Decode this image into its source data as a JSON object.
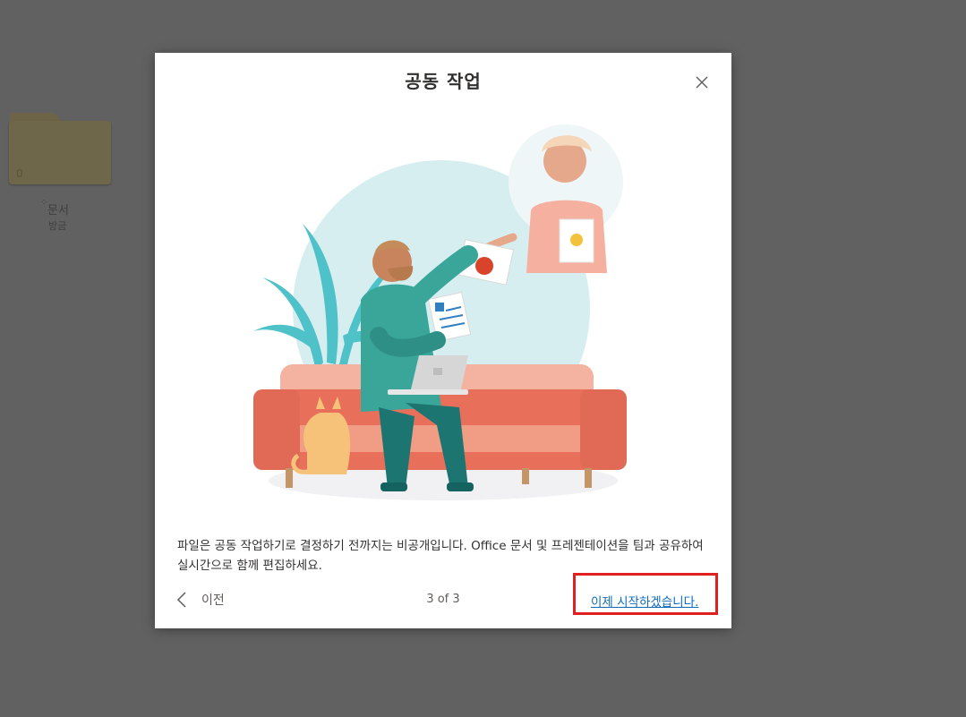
{
  "background": {
    "folder": {
      "count": "0",
      "name": "문서",
      "time": "방금"
    }
  },
  "dialog": {
    "title": "공동 작업",
    "description": "파일은 공동 작업하기로 결정하기 전까지는 비공개입니다. Office 문서 및 프레젠테이션을 팀과 공유하여 실시간으로 함께 편집하세요.",
    "prev_label": "이전",
    "page_indicator": "3 of 3",
    "start_label": "이제 시작하겠습니다."
  },
  "colors": {
    "overlay": "#616161",
    "link": "#0f6cbd",
    "highlight": "#e02020",
    "sofa": "#e8705a",
    "shirt": "#3aa69a"
  }
}
